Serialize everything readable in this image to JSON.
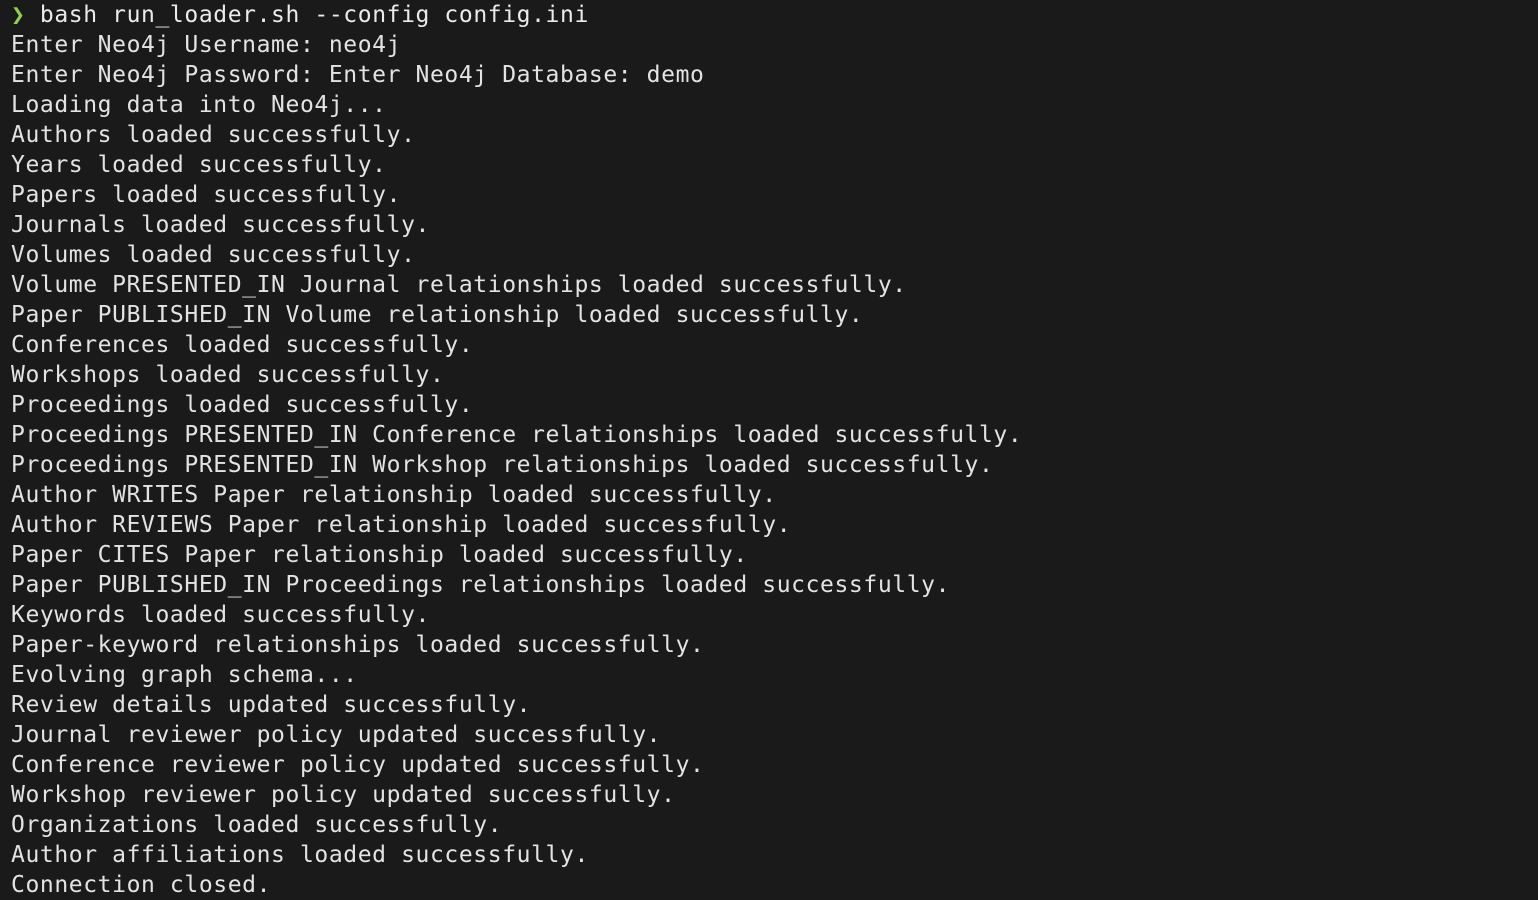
{
  "terminal": {
    "prompt": {
      "symbol": "❯",
      "command": "bash run_loader.sh --config config.ini"
    },
    "lines": [
      "Enter Neo4j Username: neo4j",
      "Enter Neo4j Password: Enter Neo4j Database: demo",
      "Loading data into Neo4j...",
      "Authors loaded successfully.",
      "Years loaded successfully.",
      "Papers loaded successfully.",
      "Journals loaded successfully.",
      "Volumes loaded successfully.",
      "Volume PRESENTED_IN Journal relationships loaded successfully.",
      "Paper PUBLISHED_IN Volume relationship loaded successfully.",
      "Conferences loaded successfully.",
      "Workshops loaded successfully.",
      "Proceedings loaded successfully.",
      "Proceedings PRESENTED_IN Conference relationships loaded successfully.",
      "Proceedings PRESENTED_IN Workshop relationships loaded successfully.",
      "Author WRITES Paper relationship loaded successfully.",
      "Author REVIEWS Paper relationship loaded successfully.",
      "Paper CITES Paper relationship loaded successfully.",
      "Paper PUBLISHED_IN Proceedings relationships loaded successfully.",
      "Keywords loaded successfully.",
      "Paper-keyword relationships loaded successfully.",
      "Evolving graph schema...",
      "Review details updated successfully.",
      "Journal reviewer policy updated successfully.",
      "Conference reviewer policy updated successfully.",
      "Workshop reviewer policy updated successfully.",
      "Organizations loaded successfully.",
      "Author affiliations loaded successfully.",
      "Connection closed."
    ]
  },
  "colors": {
    "background": "#1a1a1a",
    "text": "#e3e3e3",
    "prompt_symbol": "#8fd14f"
  }
}
